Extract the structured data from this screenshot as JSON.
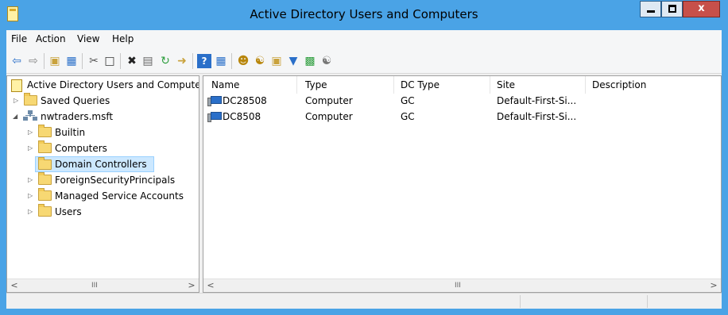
{
  "window": {
    "title": "Active Directory Users and Computers",
    "close_glyph": "x"
  },
  "menu": [
    "File",
    "Action",
    "View",
    "Help"
  ],
  "toolbar_icons": [
    "back-arrow-icon",
    "forward-arrow-icon",
    "up-folder-icon",
    "show-console-tree-icon",
    "cut-icon",
    "copy-icon",
    "delete-icon",
    "properties-icon",
    "refresh-icon",
    "export-list-icon",
    "help-icon",
    "view-icon",
    "new-user-icon",
    "new-group-icon",
    "new-ou-icon",
    "filter-icon",
    "add-to-group-icon",
    "find-icon"
  ],
  "tree": {
    "root": "Active Directory Users and Computers [",
    "items": [
      {
        "label": "Saved Queries"
      },
      {
        "label": "nwtraders.msft"
      },
      {
        "label": "Builtin"
      },
      {
        "label": "Computers"
      },
      {
        "label": "Domain Controllers"
      },
      {
        "label": "ForeignSecurityPrincipals"
      },
      {
        "label": "Managed Service Accounts"
      },
      {
        "label": "Users"
      }
    ]
  },
  "list": {
    "columns": [
      "Name",
      "Type",
      "DC Type",
      "Site",
      "Description"
    ],
    "rows": [
      {
        "name": "DC28508",
        "type": "Computer",
        "dc_type": "GC",
        "site": "Default-First-Si...",
        "description": ""
      },
      {
        "name": "DC8508",
        "type": "Computer",
        "dc_type": "GC",
        "site": "Default-First-Si...",
        "description": ""
      }
    ]
  },
  "scroll": {
    "left": "<",
    "right": ">",
    "thumb": "III"
  }
}
